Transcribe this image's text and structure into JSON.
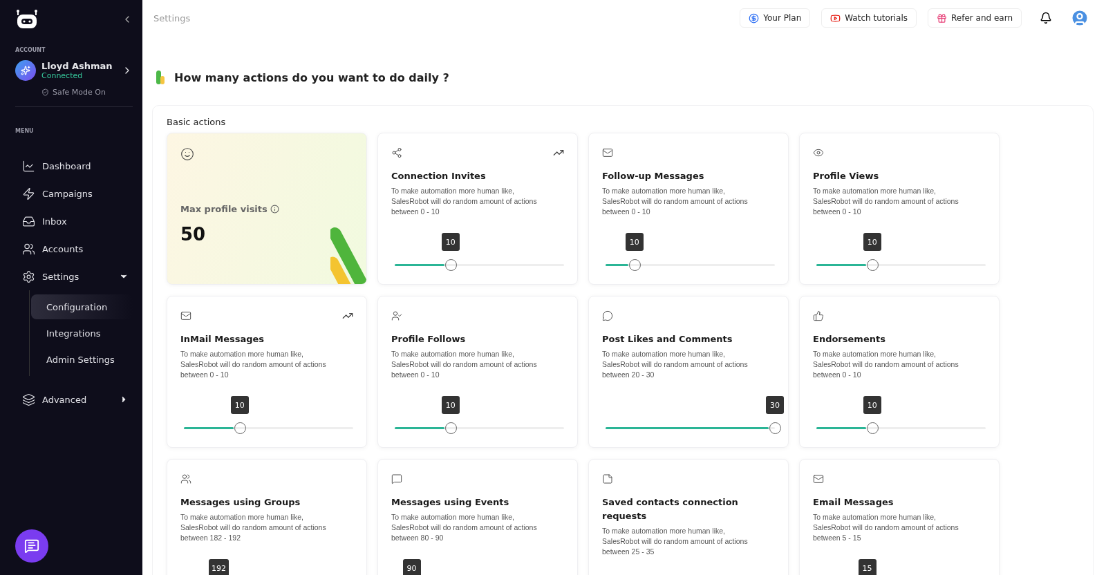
{
  "sidebar": {
    "account_label": "ACCOUNT",
    "account": {
      "name": "Lloyd Ashman",
      "status": "Connected",
      "safe_mode": "Safe Mode On"
    },
    "menu_label": "MENU",
    "items": [
      {
        "label": "Dashboard",
        "selected": false
      },
      {
        "label": "Campaigns",
        "selected": false
      },
      {
        "label": "Inbox",
        "selected": false
      },
      {
        "label": "Accounts",
        "selected": false
      },
      {
        "label": "Settings",
        "selected": false,
        "expanded": true,
        "children": [
          {
            "label": "Configuration",
            "selected": true
          },
          {
            "label": "Integrations",
            "selected": false
          },
          {
            "label": "Admin Settings",
            "selected": false
          }
        ]
      },
      {
        "label": "Advanced",
        "selected": false,
        "expanded": false
      }
    ]
  },
  "header": {
    "title": "Settings",
    "buttons": [
      "Your Plan",
      "Watch tutorials",
      "Refer and earn"
    ]
  },
  "heading": "How many actions do you want to do daily ?",
  "section_title": "Basic actions",
  "summary_card": {
    "label": "Max profile visits",
    "value": "50"
  },
  "cards": [
    {
      "title": "Connection Invites",
      "description": "To make automation more human like, SalesRobot will do random amount of actions between 0 - 10",
      "reading": "10",
      "level": 0.33,
      "trend": true
    },
    {
      "title": "Follow-up Messages",
      "description": "To make automation more human like, SalesRobot will do random amount of actions between 0 - 10",
      "reading": "10",
      "level": 0.17,
      "trend": false
    },
    {
      "title": "Profile Views",
      "description": "To make automation more human like, SalesRobot will do random amount of actions between 0 - 10",
      "reading": "10",
      "level": 0.33,
      "trend": false
    },
    {
      "title": "InMail Messages",
      "description": "To make automation more human like, SalesRobot will do random amount of actions between 0 - 10",
      "reading": "10",
      "level": 0.33,
      "trend": true
    },
    {
      "title": "Profile Follows",
      "description": "To make automation more human like, SalesRobot will do random amount of actions between 0 - 10",
      "reading": "10",
      "level": 0.33,
      "trend": false
    },
    {
      "title": "Post Likes and Comments",
      "description": "To make automation more human like, SalesRobot will do random amount of actions between 20 - 30",
      "reading": "30",
      "level": 1,
      "trend": false
    },
    {
      "title": "Endorsements",
      "description": "To make automation more human like, SalesRobot will do random amount of actions between 0 - 10",
      "reading": "10",
      "level": 0.33,
      "trend": false
    },
    {
      "title": "Messages using Groups",
      "description": "To make automation more human like, SalesRobot will do random amount of actions between 182 - 192",
      "reading": "192",
      "trend": false
    },
    {
      "title": "Messages using Events",
      "description": "To make automation more human like, SalesRobot will do random amount of actions between 80 - 90",
      "reading": "90",
      "trend": false
    },
    {
      "title": "Saved contacts connection requests",
      "description": "To make automation more human like, SalesRobot will do random amount of actions between 25 - 35",
      "trend": false
    },
    {
      "title": "Email Messages",
      "description": "To make automation more human like, SalesRobot will do random amount of actions between 5 - 15",
      "reading": "15",
      "trend": false
    }
  ]
}
